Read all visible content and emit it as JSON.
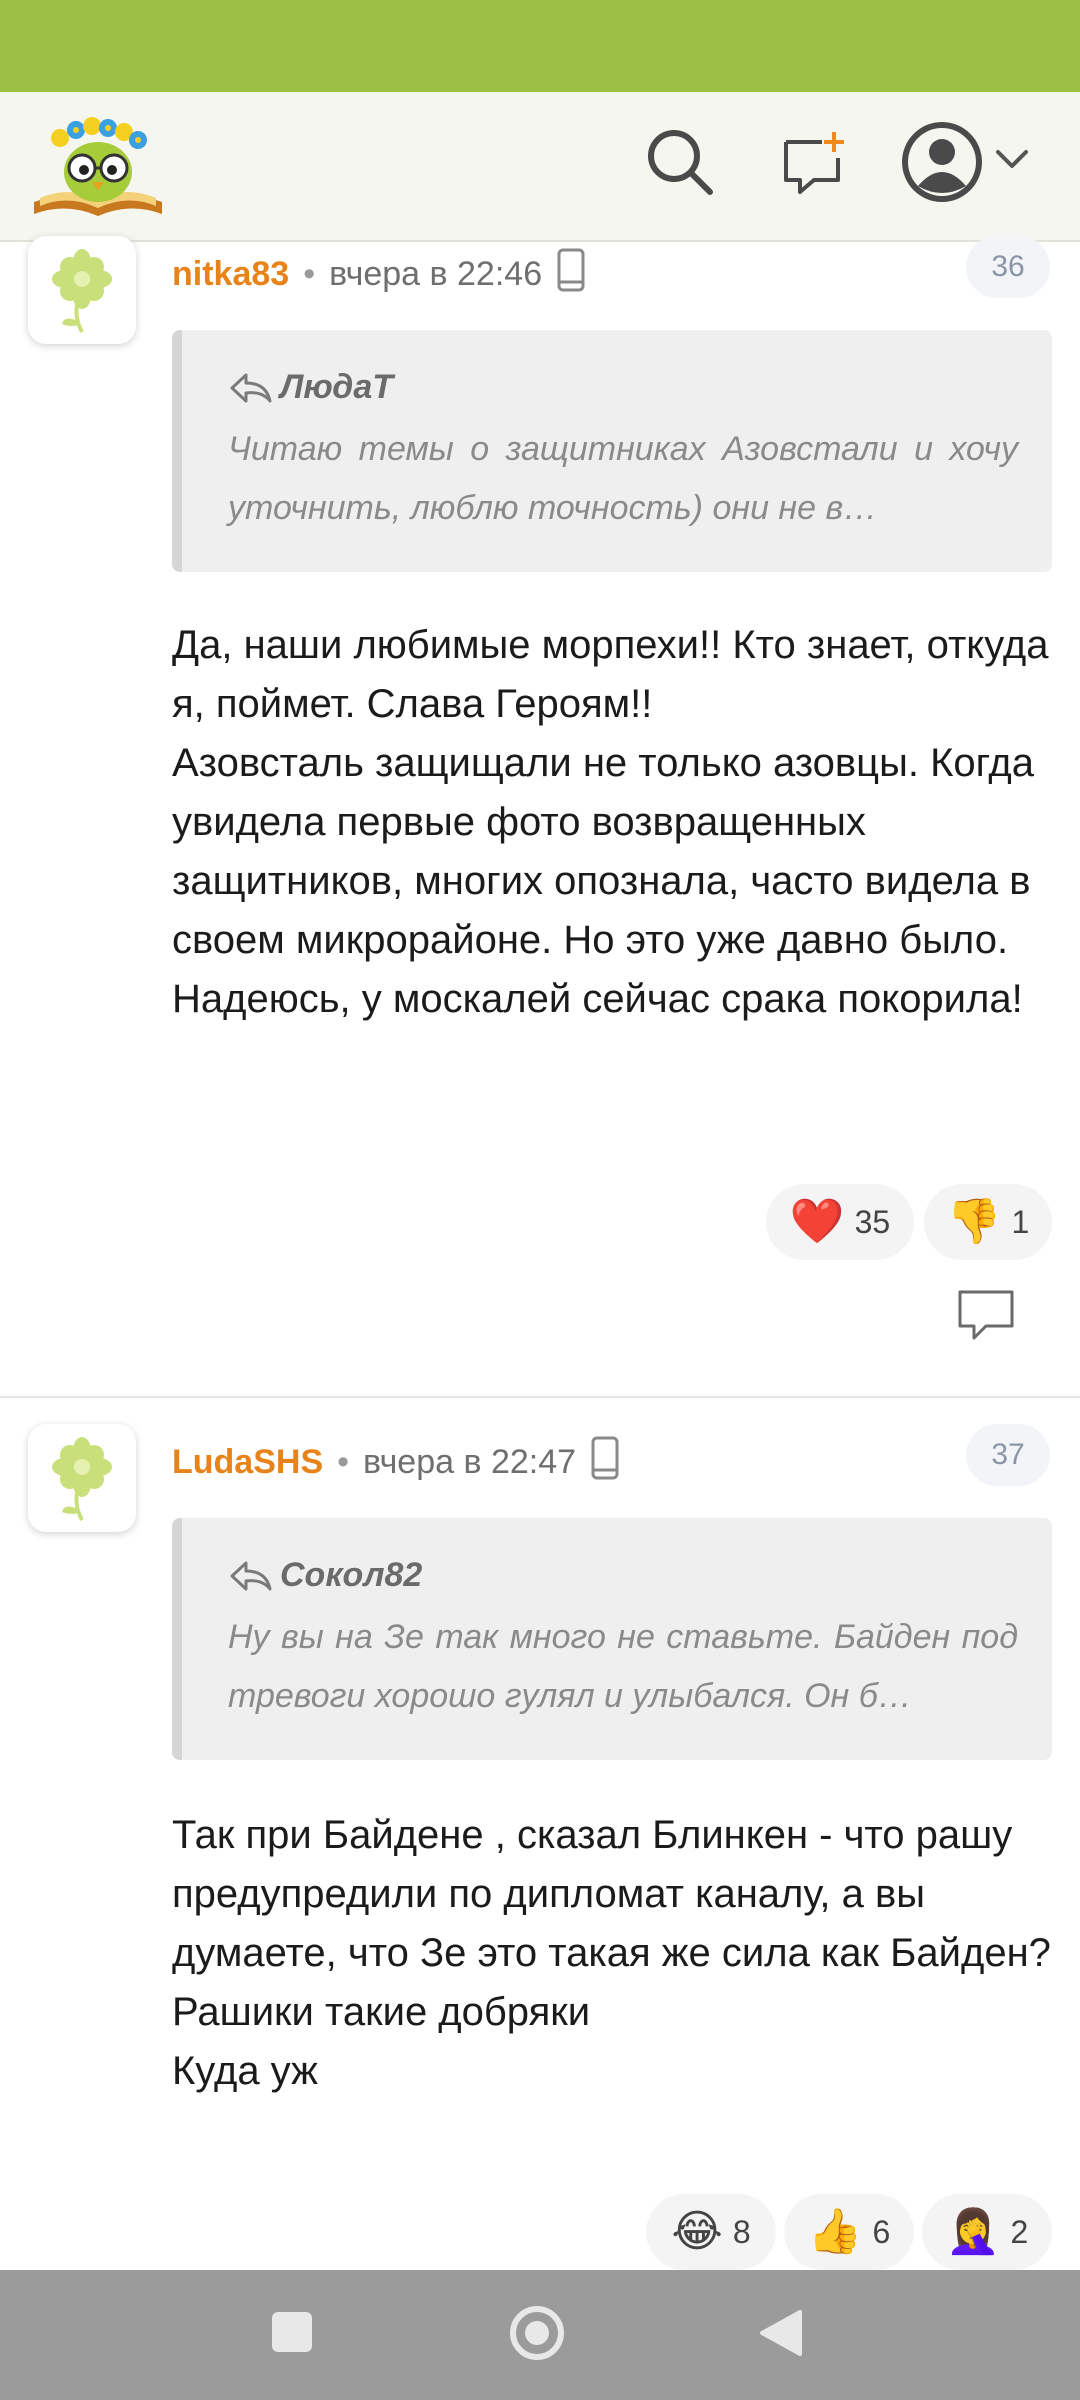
{
  "header": {
    "logo_icon": "owl-on-book-logo",
    "search_icon": "search-icon",
    "new_topic_icon": "add-comment-icon",
    "profile_icon": "user-avatar-icon",
    "menu_icon": "chevron-down-icon"
  },
  "comments": [
    {
      "author": "nitka83",
      "time": "вчера в 22:46",
      "number": "36",
      "quote_author": "ЛюдаТ",
      "quote_text": "Читаю темы о защитниках Азовстали и хочу уточнить, люблю точность) они не в…",
      "text": "Да, наши любимые морпехи!! Кто знает, откуда я, поймет. Слава Героям!!\nАзовсталь защищали не только азовцы. Когда увидела первые фото возвращенных защитников, многих опознала, часто видела в своем микрорайоне. Но это уже давно было. Надеюсь, у москалей сейчас срака покорила!",
      "reactions": [
        {
          "emoji": "❤️",
          "count": "35"
        },
        {
          "emoji": "👎",
          "count": "1"
        }
      ]
    },
    {
      "author": "LudaSHS",
      "time": "вчера в 22:47",
      "number": "37",
      "quote_author": "Сокол82",
      "quote_text": "Ну вы на Зе так много не ставьте. Байден под тревоги хорошо гулял и улыбался. Он б…",
      "text": "Так при Байдене , сказал Блинкен - что рашу предупредили по дипломат каналу, а вы думаете, что Зе это такая же сила как Байден?\nРашики такие добряки\nКуда уж",
      "reactions": [
        {
          "emoji": "😂",
          "count": "8"
        },
        {
          "emoji": "👍",
          "count": "6"
        },
        {
          "emoji": "🤦‍♀️",
          "count": "2"
        }
      ]
    }
  ],
  "colors": {
    "status_bar": "#9bc043",
    "author": "#e8831a",
    "nav_bar": "#9b9b9b"
  }
}
